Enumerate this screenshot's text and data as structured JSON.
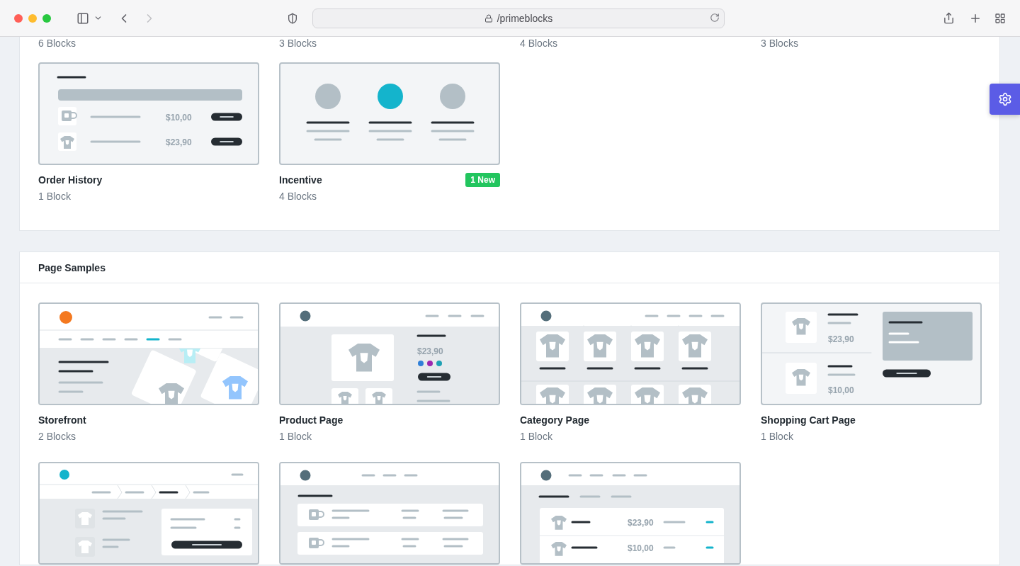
{
  "browser": {
    "address": "/primeblocks"
  },
  "sections": [
    {
      "cards": [
        {
          "count": "6 Blocks"
        },
        {
          "count": "3 Blocks"
        },
        {
          "count": "4 Blocks"
        },
        {
          "count": "3 Blocks"
        },
        {
          "title": "Order History",
          "count": "1 Block",
          "preview": {
            "kind": "order-history",
            "prices": [
              "$10,00",
              "$23,90"
            ]
          }
        },
        {
          "title": "Incentive",
          "count": "4 Blocks",
          "badge": "1 New",
          "preview": {
            "kind": "incentive"
          }
        }
      ]
    },
    {
      "title": "Page Samples",
      "cards": [
        {
          "title": "Storefront",
          "count": "2 Blocks",
          "preview": {
            "kind": "storefront"
          }
        },
        {
          "title": "Product Page",
          "count": "1 Block",
          "preview": {
            "kind": "product",
            "prices": [
              "$23,90"
            ]
          }
        },
        {
          "title": "Category Page",
          "count": "1 Block",
          "preview": {
            "kind": "category"
          }
        },
        {
          "title": "Shopping Cart Page",
          "count": "1 Block",
          "preview": {
            "kind": "cart",
            "prices": [
              "$23,90",
              "$10,00"
            ]
          }
        },
        {
          "preview": {
            "kind": "checkout"
          }
        },
        {
          "preview": {
            "kind": "order-list"
          }
        },
        {
          "preview": {
            "kind": "order-summary",
            "prices": [
              "$23,90",
              "$10,00"
            ]
          }
        }
      ]
    }
  ]
}
